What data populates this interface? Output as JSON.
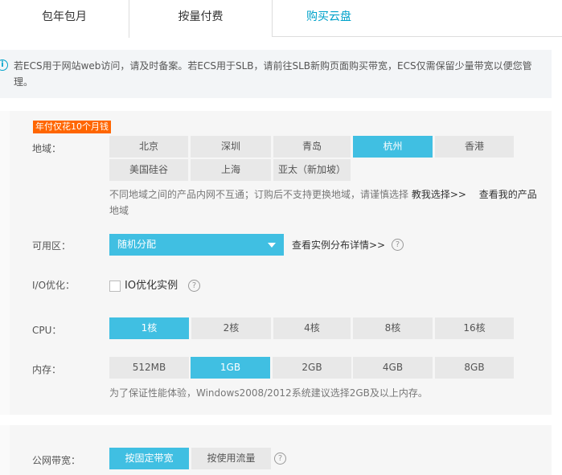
{
  "tabs": [
    "包年包月",
    "按量付费",
    "购买云盘"
  ],
  "notice": {
    "text": "若ECS用于网站web访问，请及时备案。若ECS用于SLB，请前往SLB新购页面购买带宽，ECS仅需保留少量带宽以便您管理。"
  },
  "badge": "年付仅花10个月钱",
  "region": {
    "label": "地域：",
    "options_row1": [
      "北京",
      "深圳",
      "青岛",
      "杭州",
      "香港"
    ],
    "options_row2": [
      "美国硅谷",
      "上海",
      "亚太（新加坡）"
    ],
    "selected": "杭州",
    "hint": "不同地域之间的产品内网不互通；订购后不支持更换地域，请谨慎选择",
    "hint_end": "地域",
    "help_link": "教我选择>>",
    "products_link": "查看我的产品"
  },
  "zone": {
    "label": "可用区：",
    "value": "随机分配",
    "link": "查看实例分布详情>>"
  },
  "io": {
    "label": "I/O优化：",
    "checkbox_label": "IO优化实例",
    "checked": false
  },
  "cpu": {
    "label": "CPU：",
    "options": [
      "1核",
      "2核",
      "4核",
      "8核",
      "16核"
    ],
    "selected": "1核"
  },
  "memory": {
    "label": "内存：",
    "options": [
      "512MB",
      "1GB",
      "2GB",
      "4GB",
      "8GB"
    ],
    "selected": "1GB",
    "hint": "为了保证性能体验，Windows2008/2012系统建议选择2GB及以上内存。"
  },
  "bandwidth": {
    "label": "公网带宽：",
    "options": [
      "按固定带宽",
      "按使用流量"
    ],
    "selected": "按固定带宽"
  },
  "colors": {
    "accent": "#40bfe2",
    "tab_active": "#00a2ca",
    "badge": "#ff6600"
  }
}
